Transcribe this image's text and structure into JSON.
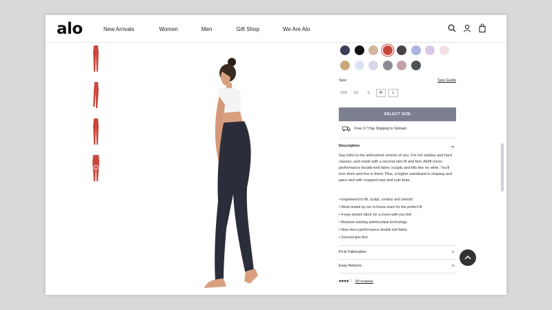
{
  "brand": "alo",
  "nav": [
    "New Arrivals",
    "Women",
    "Men",
    "Gift Shop",
    "We Are Alo"
  ],
  "header_icons": [
    "search-icon",
    "account-icon",
    "bag-icon"
  ],
  "colors": {
    "accent_button": "#7c8090",
    "thumb_product": "#c9473d",
    "swatches": [
      "#3b3f57",
      "#111111",
      "#d2b69b",
      "#c9473d",
      "#4a4245",
      "#a9b4e0",
      "#d8c9e6",
      "#f4dde6",
      "#c8a77b",
      "#d8e4f5",
      "#d9d7ec",
      "#8a8a92",
      "#c4a2a6",
      "#4c5255"
    ]
  },
  "selected_swatch_index": 3,
  "size": {
    "label": "Size:",
    "guide_label": "Size Guide",
    "options": [
      "XXS",
      "XS",
      "S",
      "M",
      "L"
    ]
  },
  "select_size_label": "SELECT SIZE",
  "shipping_text": "Free 3-7 Day Shipping to Vietnam",
  "description": {
    "title": "Description",
    "body": "Say hello to the airbrushed version of you. For hot studios and hard classes, and made with a second-skin fit and feel, Airlift micro-performance double-knit fabric sculpts and lifts like no other. You'll love them and live in them. Plus, a higher waistband is shaping and pairs well with cropped tops and cute bras.",
    "bullets": [
      "• Engineered to lift, sculpt, contour and smooth",
      "• Wear-tested by our in-house team for the perfect fit",
      "• 4-way-stretch fabric for a move-with-you feel",
      "• Moisture-wicking antimicrobial technology",
      "• New micro-performance double knit fabric",
      "• Second-skin feel"
    ]
  },
  "accordions": [
    {
      "title": "Fit & Fabrication",
      "icon": "+"
    },
    {
      "title": "Easy Returns",
      "icon": "+"
    }
  ],
  "reviews": {
    "stars": "♥♥♥♥♡",
    "count_label": "30 reviews"
  }
}
